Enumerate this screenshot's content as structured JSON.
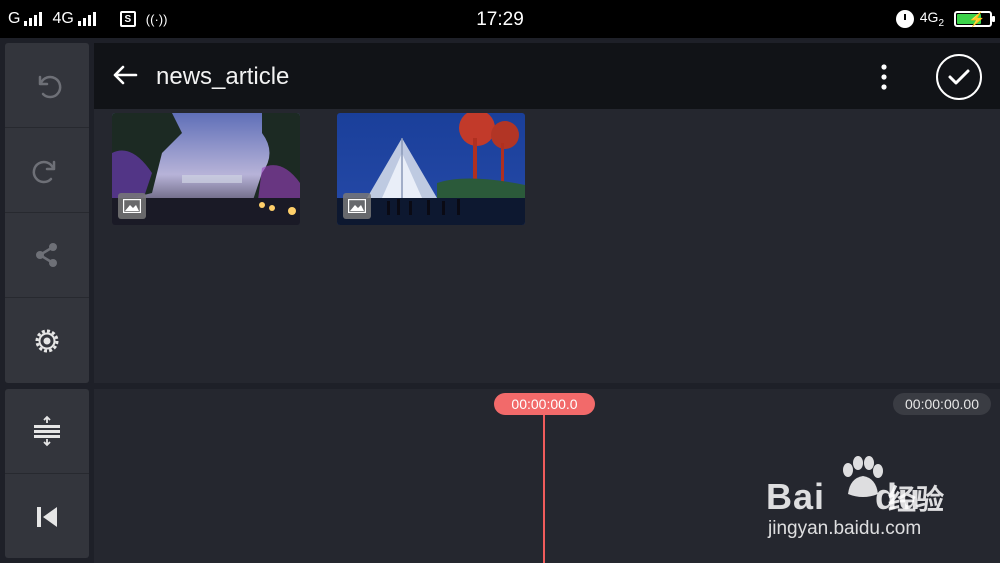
{
  "status_bar": {
    "carrier1": "G",
    "carrier2": "4G",
    "sim_badge": "S",
    "time": "17:29",
    "network_right": "4G",
    "network_right_sub": "2"
  },
  "side_toolbar": {
    "items": [
      {
        "icon": "undo-icon"
      },
      {
        "icon": "redo-icon"
      },
      {
        "icon": "share-icon"
      },
      {
        "icon": "settings-icon"
      }
    ],
    "bottom_items": [
      {
        "icon": "split-adjust-icon"
      },
      {
        "icon": "skip-to-start-icon"
      }
    ]
  },
  "header": {
    "title": "news_article"
  },
  "media": {
    "items": [
      {
        "type": "image",
        "label": "night park scene"
      },
      {
        "type": "image",
        "label": "night pavilion scene"
      }
    ]
  },
  "timeline": {
    "current_time": "00:00:00.0",
    "total_time": "00:00:00.00"
  },
  "watermark": {
    "brand_latin": "Bai",
    "brand_latin2": "du",
    "brand_cn": "经验",
    "url": "jingyan.baidu.com"
  },
  "colors": {
    "accent": "#f26a6a",
    "panel": "#33353c",
    "background": "#25272f",
    "header": "#111317"
  }
}
